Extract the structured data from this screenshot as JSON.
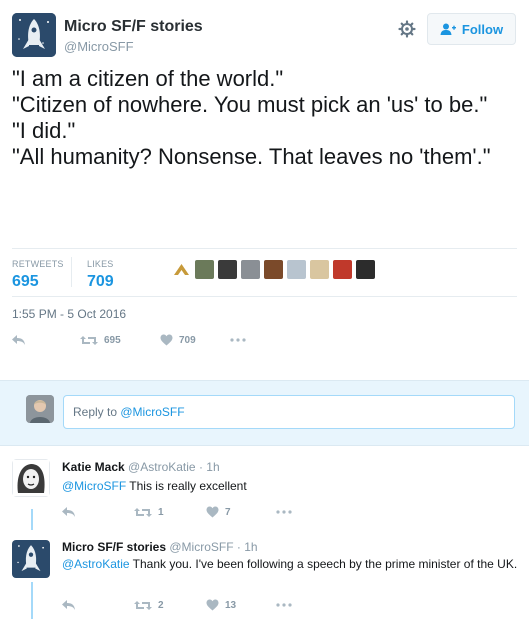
{
  "tweet": {
    "display_name": "Micro SF/F stories",
    "handle": "@MicroSFF",
    "follow_label": "Follow",
    "text_lines": [
      "\"I am a citizen of the world.\"",
      "\"Citizen of nowhere. You must pick an 'us' to be.\"",
      "\"I did.\"",
      "\"All humanity? Nonsense. That leaves no 'them'.\""
    ],
    "stats": {
      "retweets_label": "RETWEETS",
      "retweets_value": "695",
      "likes_label": "LIKES",
      "likes_value": "709"
    },
    "timestamp": "1:55 PM - 5 Oct 2016",
    "actions": {
      "retweet_count": "695",
      "like_count": "709"
    },
    "likers": [
      "#c79a3a",
      "#6b7a5a",
      "#3a3a3a",
      "#8a8f95",
      "#7b4a2a",
      "#b8c4cf",
      "#d9c6a0",
      "#c0392b",
      "#2c2c2c"
    ]
  },
  "reply_box": {
    "prefix": "Reply to ",
    "mention": "@MicroSFF"
  },
  "replies": [
    {
      "name": "Katie Mack",
      "handle": "@AstroKatie",
      "time": "· 1h",
      "mention": "@MicroSFF",
      "text": " This is really excellent",
      "retweets": "1",
      "likes": "7"
    },
    {
      "name": "Micro SF/F stories",
      "handle": "@MicroSFF",
      "time": "· 1h",
      "mention": "@AstroKatie",
      "text": " Thank you. I've been following a speech by the prime minister of the UK.",
      "retweets": "2",
      "likes": "13"
    }
  ],
  "colors": {
    "link": "#1b95e0",
    "muted": "#8899a6",
    "reply_bg": "#e8f5fd"
  }
}
